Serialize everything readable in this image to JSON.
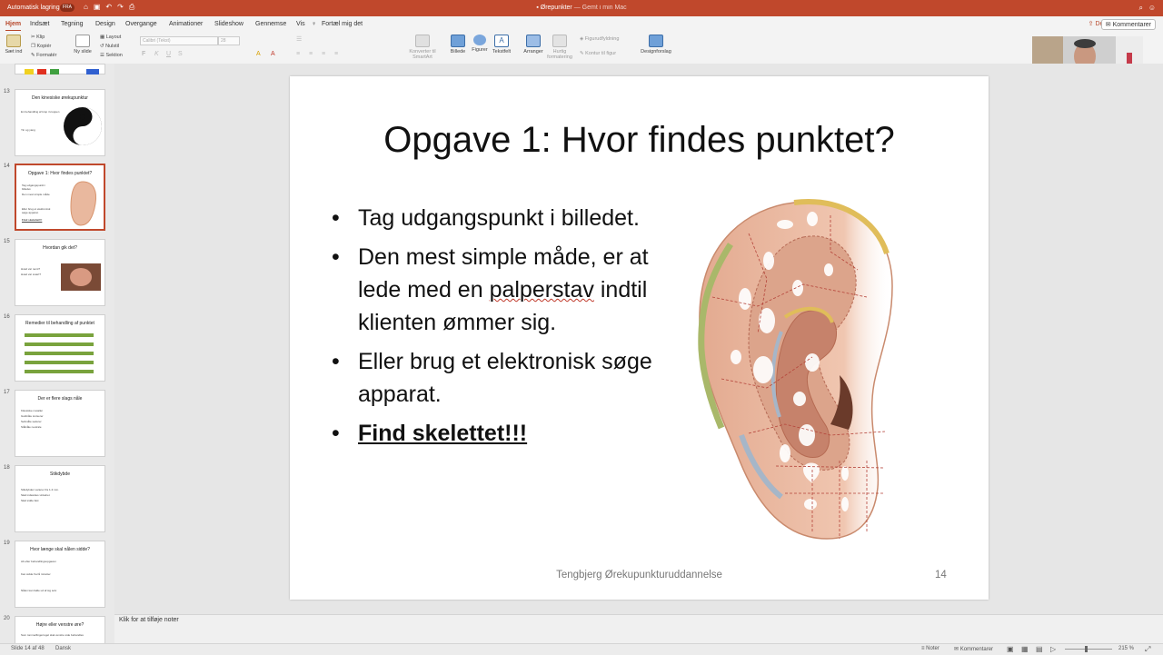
{
  "titlebar": {
    "autosave": "Automatisk lagring",
    "toggle": "FRA",
    "document": "Ørepunkter",
    "saved": "— Gemt i min Mac"
  },
  "menu": {
    "tabs": [
      "Hjem",
      "Indsæt",
      "Tegning",
      "Design",
      "Overgange",
      "Animationer",
      "Slideshow",
      "Gennemse",
      "Vis"
    ],
    "tellme": "Fortæl mig det",
    "share": "Del",
    "comments": "Kommentarer"
  },
  "ribbon": {
    "paste": "Sæt ind",
    "cut": "Klip",
    "copy": "Kopiér",
    "format": "Formatér",
    "new_slide": "Ny slide",
    "layout": "Layout",
    "reset": "Nulstil",
    "section": "Sektion",
    "font": "Calibri (Tekst)",
    "size": "28",
    "smartart": "Konverter til SmartArt",
    "picture": "Billede",
    "shapes": "Figurer",
    "textbox": "Tekstfelt",
    "arrange": "Arranger",
    "quick_styles": "Hurtig formatering",
    "fill": "Figurudfyldning",
    "outline": "Kontur til figur",
    "designer": "Designforslag"
  },
  "thumbnails": [
    {
      "num": "13",
      "title": "Den kinesiske ørekupunktur",
      "lines": [
        "En behandling af krop i kroppen",
        "Yin og yang"
      ],
      "selected": false
    },
    {
      "num": "14",
      "title": "Opgave 1: Hvor findes punktet?",
      "lines": [
        "Tag udgangspunkt i billedet.",
        "Den mest simple måde",
        "Eller brug et elektronisk søge apparat.",
        "Find skelettet!!!"
      ],
      "selected": true
    },
    {
      "num": "15",
      "title": "Hvordan gik det?",
      "lines": [
        "Hvad var nemt?",
        "Hvad var svært?"
      ],
      "selected": false
    },
    {
      "num": "16",
      "title": "Remedier til behandling af punktet",
      "lines": [],
      "selected": false
    },
    {
      "num": "17",
      "title": "Der er flere slags nåle",
      "lines": [
        "Klassiske metaller",
        "Guldnåle toniserer",
        "Sølvnåle sederer",
        "Stålnåle neutrale"
      ],
      "selected": false
    },
    {
      "num": "18",
      "title": "Stikdybde",
      "lines": [
        "Stikdybden varierer fra 1-3 mm.",
        "Skal indsættes vinkelret",
        "Skal sidde fast"
      ],
      "selected": false
    },
    {
      "num": "19",
      "title": "Hvor længe skal nålen sidde?",
      "lines": [
        "Alt efter behandlingsopgaven",
        "Kan sidde fra få minutter",
        "Nålen kan falde ud af sig selv"
      ],
      "selected": false
    },
    {
      "num": "20",
      "title": "Højre eller venstre øre?",
      "lines": [
        "Som tommelfingerregel skal venstre side behandles"
      ],
      "selected": false
    }
  ],
  "slide": {
    "title": "Opgave 1: Hvor findes punktet?",
    "bullet1": "Tag udgangspunkt i billedet.",
    "bullet2_pre": "Den mest simple måde, er at lede med en",
    "bullet2_spell": "palperstav",
    "bullet2_post": "indtil klienten ømmer sig.",
    "bullet3": "Eller brug et elektronisk søge apparat.",
    "bullet4": "Find skelettet!!!",
    "footer": "Tengbjerg Ørekupunkturuddannelse",
    "page": "14"
  },
  "notes_placeholder": "Klik for at tilføje noter",
  "status": {
    "slide": "Slide 14 af 48",
    "language": "Dansk",
    "notes": "Noter",
    "comments": "Kommentarer",
    "zoom": "215 %"
  },
  "colors": {
    "accent": "#c0482c",
    "slide_bg": "#ffffff"
  }
}
